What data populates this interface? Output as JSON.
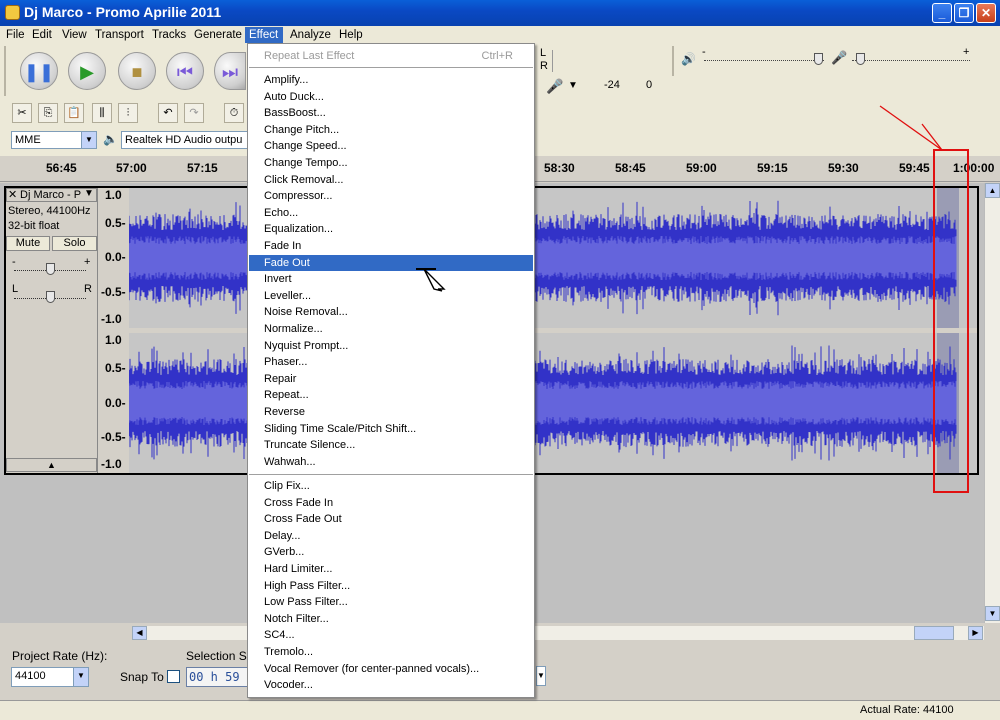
{
  "window": {
    "title": "Dj Marco - Promo Aprilie 2011"
  },
  "menubar": [
    "File",
    "Edit",
    "View",
    "Transport",
    "Tracks",
    "Generate",
    "Effect",
    "Analyze",
    "Help"
  ],
  "transport_icons": [
    "pause-icon",
    "play-icon",
    "stop-icon",
    "skip-start-icon",
    "skip-end-icon"
  ],
  "meters": {
    "l": "L",
    "r": "R",
    "db": "-24",
    "zero": "0",
    "minus": "-",
    "plus": "+"
  },
  "device": {
    "host": "MME",
    "output": "Realtek HD Audio outpu"
  },
  "ruler": {
    "ticks": [
      "56:45",
      "57:00",
      "57:15",
      "58:30",
      "58:45",
      "59:00",
      "59:15",
      "59:30",
      "59:45",
      "1:00:00"
    ]
  },
  "track": {
    "name": "Dj Marco - P",
    "format": "Stereo, 44100Hz",
    "bits": "32-bit float",
    "mute": "Mute",
    "solo": "Solo",
    "gain_minus": "-",
    "gain_plus": "+",
    "pan_l": "L",
    "pan_r": "R",
    "scale": [
      "1.0",
      "0.5-",
      "0.0-",
      "-0.5-",
      "-1.0"
    ]
  },
  "effect_menu": {
    "repeat_last": "Repeat Last Effect",
    "repeat_shortcut": "Ctrl+R",
    "group1": [
      "Amplify...",
      "Auto Duck...",
      "BassBoost...",
      "Change Pitch...",
      "Change Speed...",
      "Change Tempo...",
      "Click Removal...",
      "Compressor...",
      "Echo...",
      "Equalization...",
      "Fade In",
      "Fade Out",
      "Invert",
      "Leveller...",
      "Noise Removal...",
      "Normalize...",
      "Nyquist Prompt...",
      "Phaser...",
      "Repair",
      "Repeat...",
      "Reverse",
      "Sliding Time Scale/Pitch Shift...",
      "Truncate Silence...",
      "Wahwah..."
    ],
    "group2": [
      "Clip Fix...",
      "Cross Fade In",
      "Cross Fade Out",
      "Delay...",
      "GVerb...",
      "Hard Limiter...",
      "High Pass Filter...",
      "Low Pass Filter...",
      "Notch Filter...",
      "SC4...",
      "Tremolo...",
      "Vocal Remover (for center-panned vocals)...",
      "Vocoder..."
    ],
    "highlighted": "Fade Out"
  },
  "bottom": {
    "project_rate_label": "Project Rate (Hz):",
    "project_rate": "44100",
    "snap_label": "Snap To",
    "selection_label": "Selection S",
    "time_value": "00 h 59"
  },
  "status": {
    "actual_rate": "Actual Rate: 44100"
  },
  "colors": {
    "waveform": "#3232c8",
    "waveform_light": "#6464dc",
    "highlight": "#316ac5",
    "annotation": "#e01010"
  }
}
